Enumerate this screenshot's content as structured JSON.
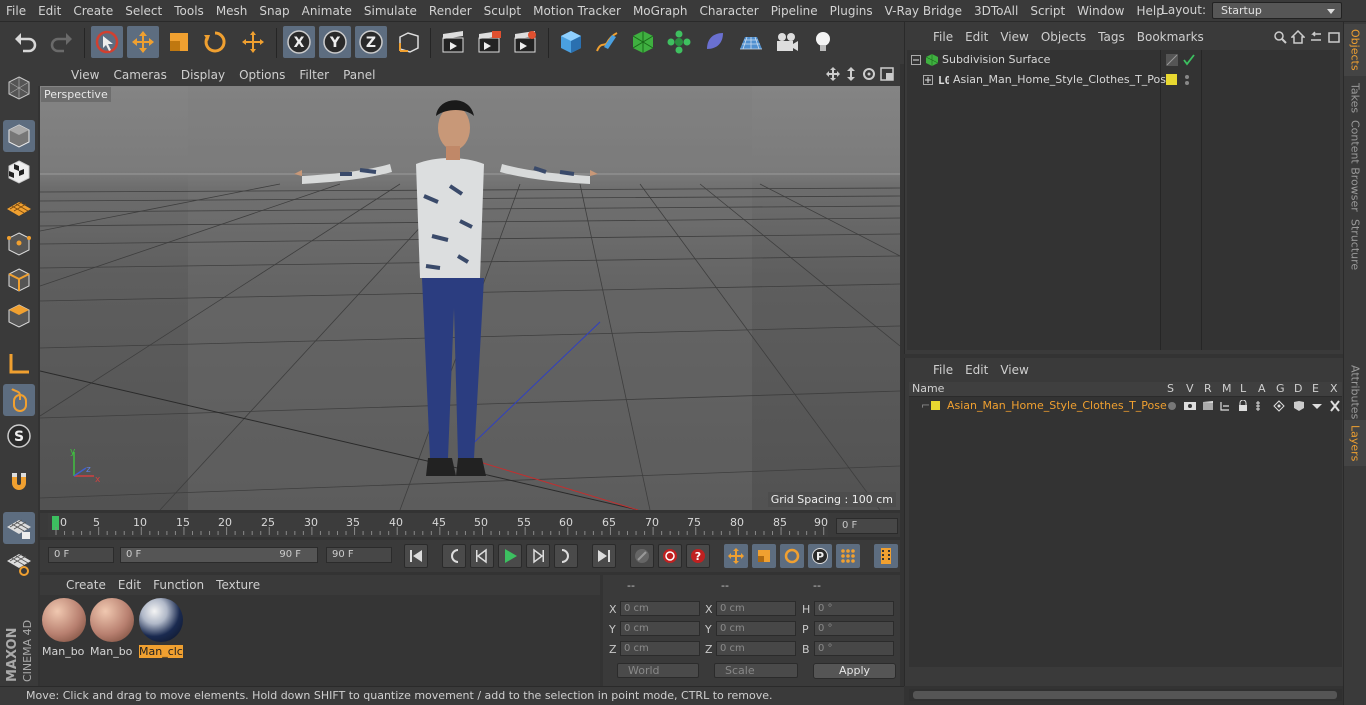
{
  "menubar": {
    "items": [
      "File",
      "Edit",
      "Create",
      "Select",
      "Tools",
      "Mesh",
      "Snap",
      "Animate",
      "Simulate",
      "Render",
      "Sculpt",
      "Motion Tracker",
      "MoGraph",
      "Character",
      "Pipeline",
      "Plugins",
      "V-Ray Bridge",
      "3DToAll",
      "Script",
      "Window",
      "Help"
    ],
    "layout_label": "Layout:",
    "layout_value": "Startup"
  },
  "viewport": {
    "menu": [
      "View",
      "Cameras",
      "Display",
      "Options",
      "Filter",
      "Panel"
    ],
    "label": "Perspective",
    "grid_spacing": "Grid Spacing : 100 cm",
    "axes": {
      "y": "y",
      "z": "z",
      "x": "x"
    }
  },
  "timeline": {
    "ticks": [
      "0",
      "5",
      "10",
      "15",
      "20",
      "25",
      "30",
      "35",
      "40",
      "45",
      "50",
      "55",
      "60",
      "65",
      "70",
      "75",
      "80",
      "85",
      "90"
    ],
    "current_frame": "0 F",
    "start_field": "0 F",
    "range_start": "0 F",
    "range_end": "90 F",
    "end_field": "90 F"
  },
  "materials": {
    "menu": [
      "Create",
      "Edit",
      "Function",
      "Texture"
    ],
    "items": [
      {
        "name": "Man_bo",
        "selected": false
      },
      {
        "name": "Man_bo",
        "selected": false
      },
      {
        "name": "Man_clc",
        "selected": true
      }
    ]
  },
  "coords": {
    "headers": [
      "--",
      "--",
      "--"
    ],
    "rows": [
      {
        "l1": "X",
        "v1": "0 cm",
        "l2": "X",
        "v2": "0 cm",
        "l3": "H",
        "v3": "0 °"
      },
      {
        "l1": "Y",
        "v1": "0 cm",
        "l2": "Y",
        "v2": "0 cm",
        "l3": "P",
        "v3": "0 °"
      },
      {
        "l1": "Z",
        "v1": "0 cm",
        "l2": "Z",
        "v2": "0 cm",
        "l3": "B",
        "v3": "0 °"
      }
    ],
    "space": "World",
    "mode": "Scale",
    "apply": "Apply"
  },
  "status": "Move: Click and drag to move elements. Hold down SHIFT to quantize movement / add to the selection in point mode, CTRL to remove.",
  "objects": {
    "menu": [
      "File",
      "Edit",
      "View",
      "Objects",
      "Tags",
      "Bookmarks"
    ],
    "tree": [
      "Subdivision Surface",
      "Asian_Man_Home_Style_Clothes_T_Pose"
    ]
  },
  "layers": {
    "menu": [
      "File",
      "Edit",
      "View"
    ],
    "columns": [
      "Name",
      "S",
      "V",
      "R",
      "M",
      "L",
      "A",
      "G",
      "D",
      "E",
      "X"
    ],
    "rows": [
      "Asian_Man_Home_Style_Clothes_T_Pose"
    ],
    "layer_color": "#e8d830"
  },
  "side_tabs": [
    "Objects",
    "Takes",
    "Content Browser",
    "Structure",
    "Attributes",
    "Layers"
  ],
  "colors": {
    "accent": "#f0a030",
    "selection": "#5d6d80"
  }
}
